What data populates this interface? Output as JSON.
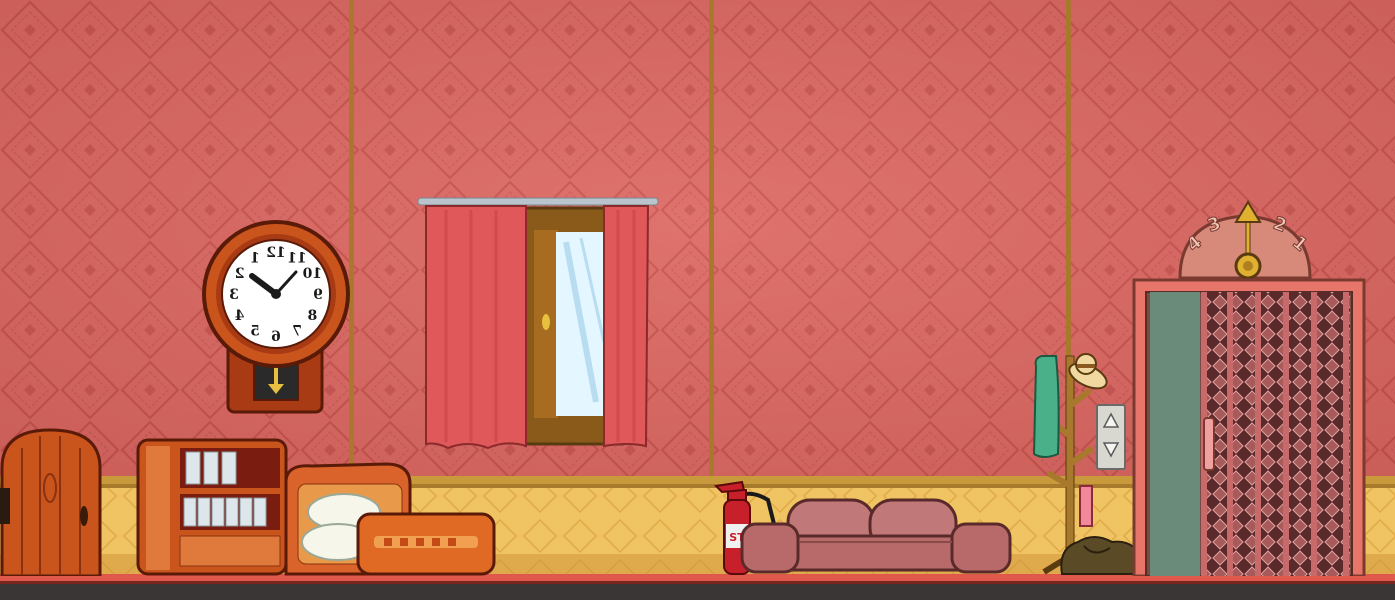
{
  "scene": {
    "name": "elevator-lobby-room",
    "colors": {
      "wall": "#d9625c",
      "wall_pattern": "#c9504c",
      "panel_trim": "#a8782c",
      "wainscot": "#f0c462",
      "floor_strip": "#e0574c",
      "floor_dark": "#3a3636",
      "wood": "#c9541c",
      "wood_dark": "#7a2c10",
      "curtain": "#e0585a",
      "sofa": "#b86a6a",
      "extinguisher": "#c8202a",
      "elevator_frame": "#e8756a",
      "elevator_gate": "#7a3a3a"
    },
    "clock": {
      "numerals": [
        "12",
        "1",
        "2",
        "3",
        "4",
        "5",
        "6",
        "7",
        "8",
        "9",
        "10",
        "11"
      ],
      "style": "mirrored"
    },
    "extinguisher_label": "ST",
    "elevator": {
      "dial_numbers": [
        "4",
        "3",
        "2",
        "1"
      ],
      "call_buttons": [
        "up-arrow-icon",
        "down-arrow-icon"
      ]
    },
    "icons": [
      "up-arrow-icon",
      "down-arrow-icon",
      "clock-icon",
      "hat-icon"
    ]
  }
}
